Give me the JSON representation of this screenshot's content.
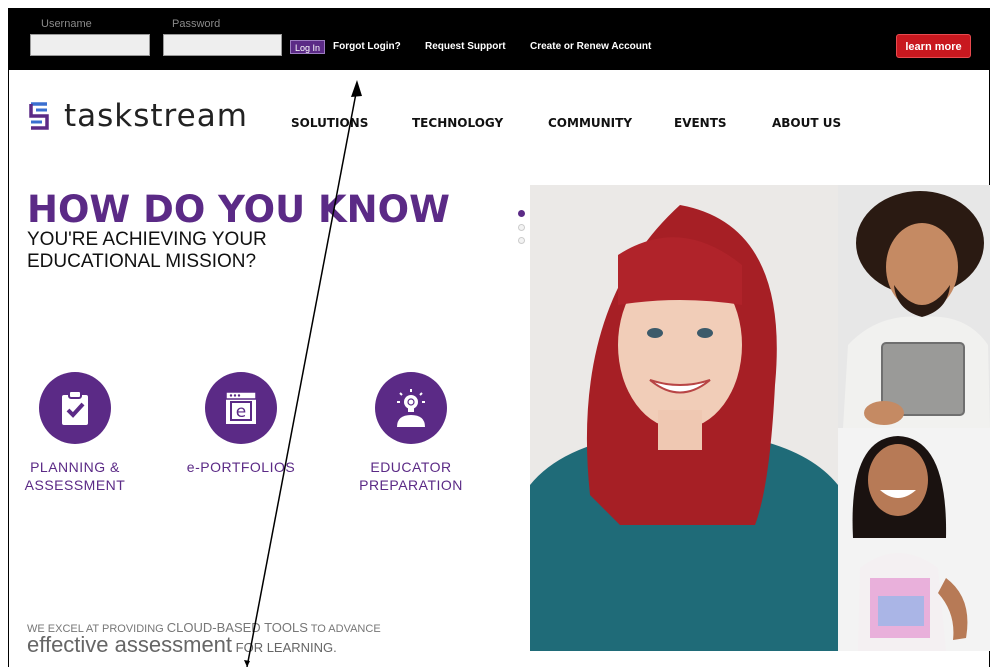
{
  "topbar": {
    "username_label": "Username",
    "password_label": "Password",
    "login_button": "Log In",
    "links": [
      "Forgot Login?",
      "Request Support",
      "Create or Renew Account"
    ],
    "learn_more": "learn more"
  },
  "header": {
    "logo_text": "taskstream",
    "nav": [
      "SOLUTIONS",
      "TECHNOLOGY",
      "COMMUNITY",
      "EVENTS",
      "ABOUT US"
    ]
  },
  "hero": {
    "title": "HOW DO YOU KNOW",
    "subtitle_line1": "YOU'RE ACHIEVING YOUR",
    "subtitle_line2": "EDUCATIONAL MISSION?"
  },
  "features": [
    {
      "line1": "PLANNING &",
      "line2": "ASSESSMENT",
      "icon": "clipboard-check-icon"
    },
    {
      "line1": "e-PORTFOLIOS",
      "line2": "",
      "icon": "e-portfolio-icon"
    },
    {
      "line1": "EDUCATOR",
      "line2": "PREPARATION",
      "icon": "lightbulb-person-icon"
    }
  ],
  "tagline": {
    "part1": "WE EXCEL AT PROVIDING ",
    "part2": "CLOUD-BASED TOOLS",
    "part3": " TO ADVANCE",
    "part4": "effective assessment",
    "part5": " FOR LEARNING."
  },
  "colors": {
    "brand_purple": "#5b2a86",
    "learn_more_red": "#c8181f",
    "topbar": "#000000"
  }
}
